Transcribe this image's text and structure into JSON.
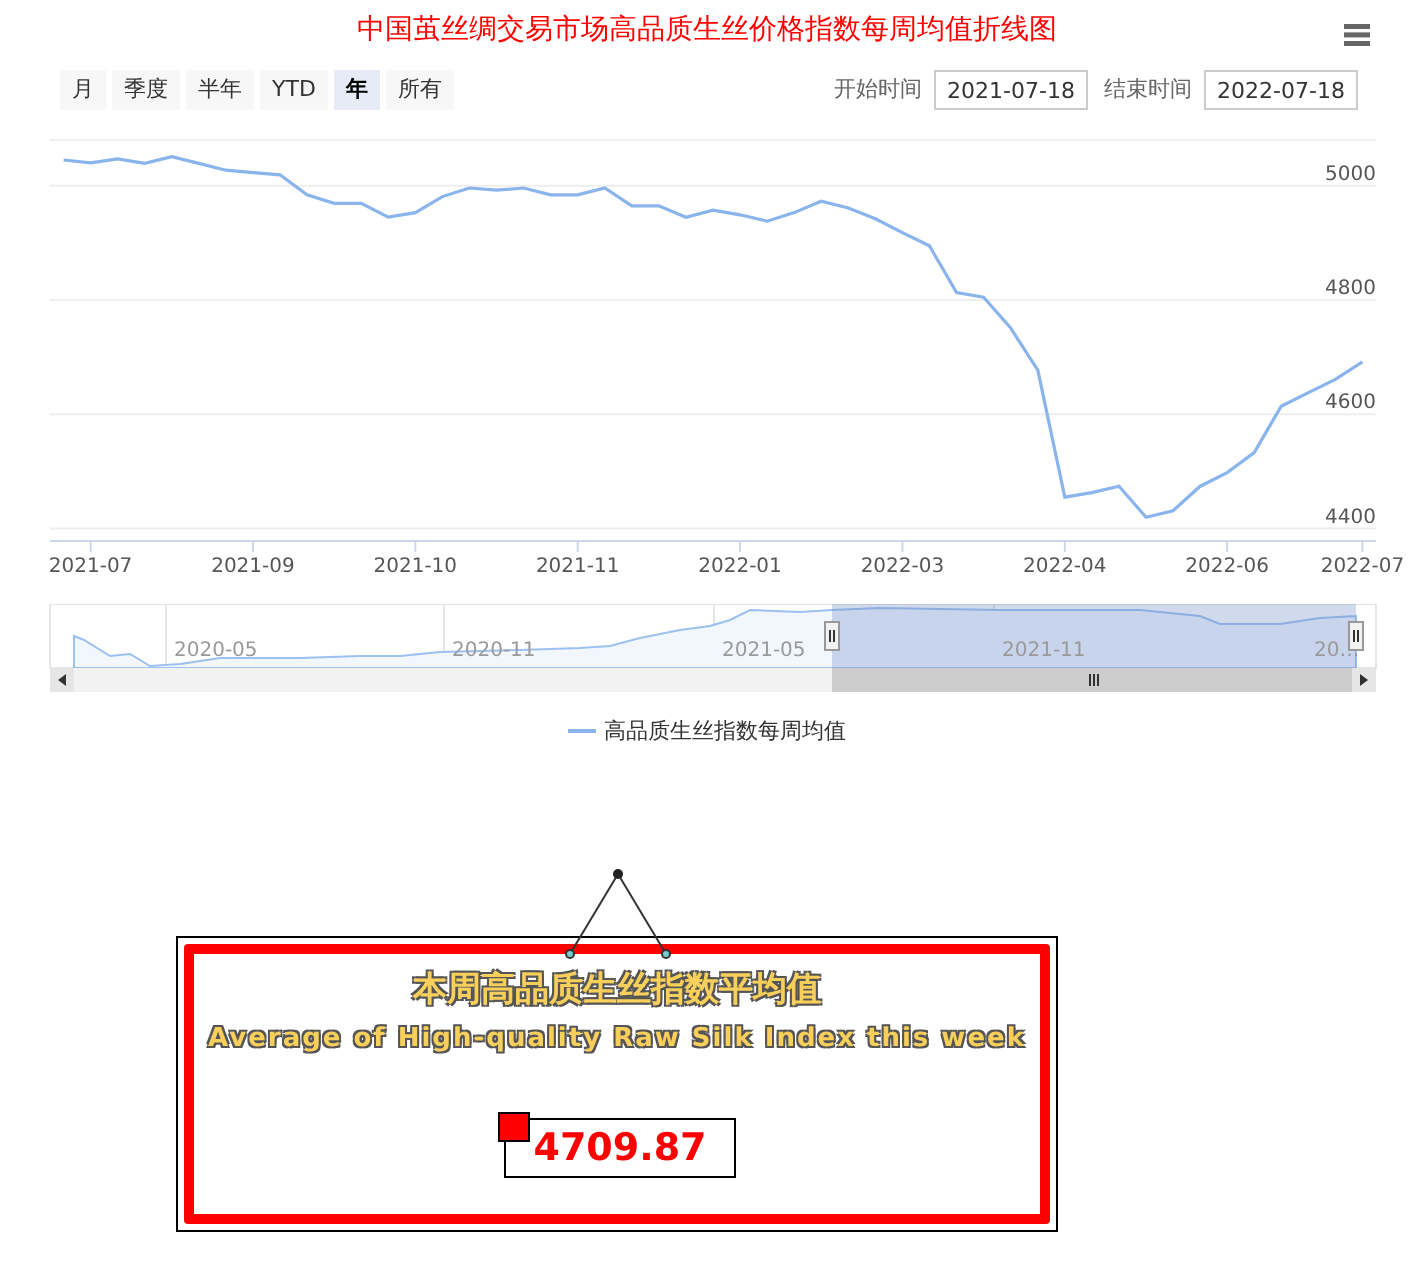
{
  "title": "中国茧丝绸交易市场高品质生丝价格指数每周均值折线图",
  "toolbar": {
    "range_buttons": [
      {
        "label": "月",
        "selected": false
      },
      {
        "label": "季度",
        "selected": false
      },
      {
        "label": "半年",
        "selected": false
      },
      {
        "label": "YTD",
        "selected": false
      },
      {
        "label": "年",
        "selected": true
      },
      {
        "label": "所有",
        "selected": false
      }
    ],
    "start_label": "开始时间",
    "start_value": "2021-07-18",
    "end_label": "结束时间",
    "end_value": "2022-07-18"
  },
  "chart": {
    "chart_data": {
      "type": "line",
      "categories": [
        null,
        "2021-07",
        null,
        null,
        null,
        null,
        null,
        "2021-09",
        null,
        null,
        null,
        null,
        null,
        "2021-10",
        null,
        null,
        null,
        null,
        null,
        "2021-11",
        null,
        null,
        null,
        null,
        null,
        "2022-01",
        null,
        null,
        null,
        null,
        null,
        "2022-03",
        null,
        null,
        null,
        null,
        null,
        "2022-04",
        null,
        null,
        null,
        null,
        null,
        "2022-06",
        null,
        null,
        null,
        null,
        "2022-07"
      ],
      "series": [
        {
          "name": "高品质生丝指数每周均值",
          "color": "#8ab4ec",
          "values": [
            5045,
            5040,
            5047,
            5039,
            5051,
            5039,
            5027,
            5023,
            5019,
            4984,
            4969,
            4969,
            4945,
            4953,
            4981,
            4996,
            4992,
            4996,
            4984,
            4984,
            4996,
            4965,
            4965,
            4945,
            4957,
            4949,
            4938,
            4953,
            4973,
            4961,
            4942,
            4918,
            4895,
            4813,
            4805,
            4751,
            4677,
            4455,
            4463,
            4474,
            4420,
            4431,
            4474,
            4498,
            4533,
            4614,
            4638,
            4661,
            4692
          ]
        }
      ],
      "ylim": [
        4380,
        5080
      ],
      "grid": true,
      "yticks": [
        4400,
        4600,
        4800,
        5000
      ]
    }
  },
  "navigator": {
    "labels": [
      "2020-05",
      "2020-11",
      "2021-05",
      "2021-11",
      "20…"
    ]
  },
  "card": {
    "title_zh": "本周高品质生丝指数平均值",
    "title_en": "Average of High-quality Raw Silk Index this week",
    "value": "4709.87"
  }
}
